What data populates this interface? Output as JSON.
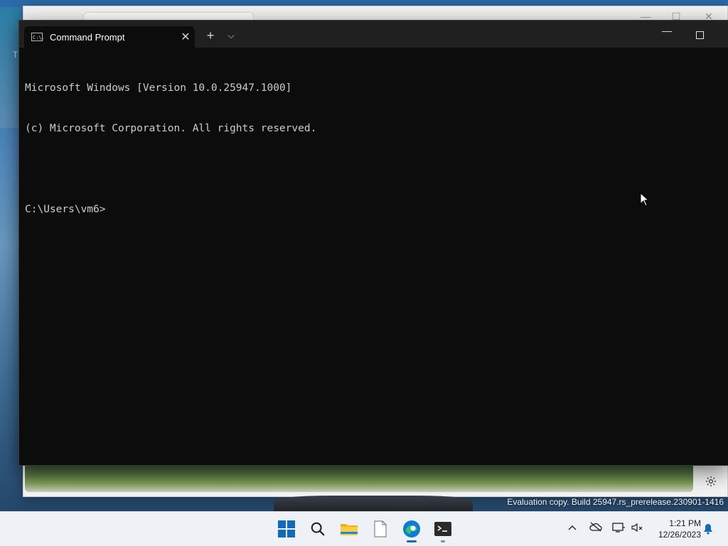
{
  "terminal": {
    "tab_title": "Command Prompt",
    "tab_icon_text": "C:\\.",
    "new_tab_glyph": "+",
    "dropdown_glyph": "⌵",
    "close_glyph": "✕",
    "minimize_glyph": "—",
    "lines": [
      "Microsoft Windows [Version 10.0.25947.1000]",
      "(c) Microsoft Corporation. All rights reserved.",
      "",
      "C:\\Users\\vm6>"
    ]
  },
  "background_window": {
    "left_edge_letter": "T"
  },
  "desktop": {
    "watermark": "Evaluation copy. Build 25947.rs_prerelease.230901-1416"
  },
  "taskbar": {
    "icons": [
      "windows-start-icon",
      "search-icon",
      "file-explorer-icon",
      "notepad-icon",
      "edge-icon",
      "terminal-icon"
    ],
    "tray_icons": [
      "chevron-up-icon",
      "onedrive-offline-icon",
      "network-icon",
      "volume-muted-icon",
      "notification-bell-icon"
    ],
    "time": "1:21 PM",
    "date": "12/26/2023",
    "accent": "#0f6cbd"
  }
}
